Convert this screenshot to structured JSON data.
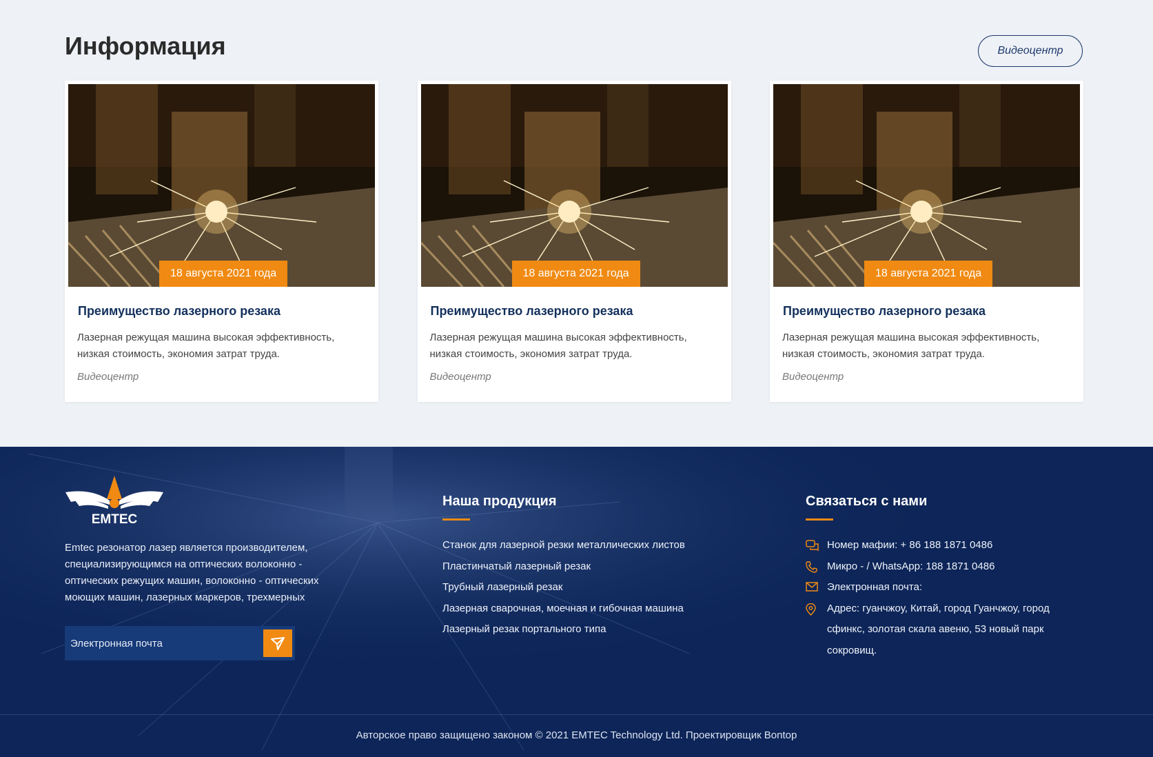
{
  "info": {
    "title": "Информация",
    "button_label": "Видеоцентр",
    "cards": [
      {
        "date": "18 августа 2021 года",
        "title": "Преимущество лазерного резака",
        "text": "Лазерная режущая машина высокая эффективность, низкая стоимость, экономия затрат труда.",
        "category": "Видеоцентр"
      },
      {
        "date": "18 августа 2021 года",
        "title": "Преимущество лазерного резака",
        "text": "Лазерная режущая машина высокая эффективность, низкая стоимость, экономия затрат труда.",
        "category": "Видеоцентр"
      },
      {
        "date": "18 августа 2021 года",
        "title": "Преимущество лазерного резака",
        "text": "Лазерная режущая машина высокая эффективность, низкая стоимость, экономия затрат труда.",
        "category": "Видеоцентр"
      }
    ]
  },
  "footer": {
    "logo_text": "EMTEC",
    "about": "Emtec резонатор лазер является производителем, специализирующимся на оптических волоконно - оптических режущих машин, волоконно - оптических моющих машин, лазерных маркеров, трехмерных",
    "subscribe": {
      "placeholder": "Электронная почта"
    },
    "products": {
      "title": "Наша продукция",
      "items": [
        "Станок для лазерной резки металлических листов",
        "Пластинчатый лазерный резак",
        "Трубный лазерный резак",
        "Лазерная сварочная, моечная и гибочная машина",
        "Лазерный резак портального типа"
      ]
    },
    "contacts": {
      "title": "Связаться с нами",
      "phone": "Номер мафии: + 86 188 1871 0486",
      "whatsapp": "Микро - / WhatsApp: 188 1871 0486",
      "email": "Электронная почта:",
      "address": "Адрес: гуанчжоу, Китай, город Гуанчжоу, город сфинкс, золотая скала авеню, 53 новый парк сокровищ."
    },
    "copyright": "Авторское право защищено законом © 2021 EMTEC Technology Ltd.   Проектировщик Bontop"
  },
  "colors": {
    "accent": "#f08a12",
    "navy": "#0d2558",
    "title_blue": "#13305c"
  }
}
